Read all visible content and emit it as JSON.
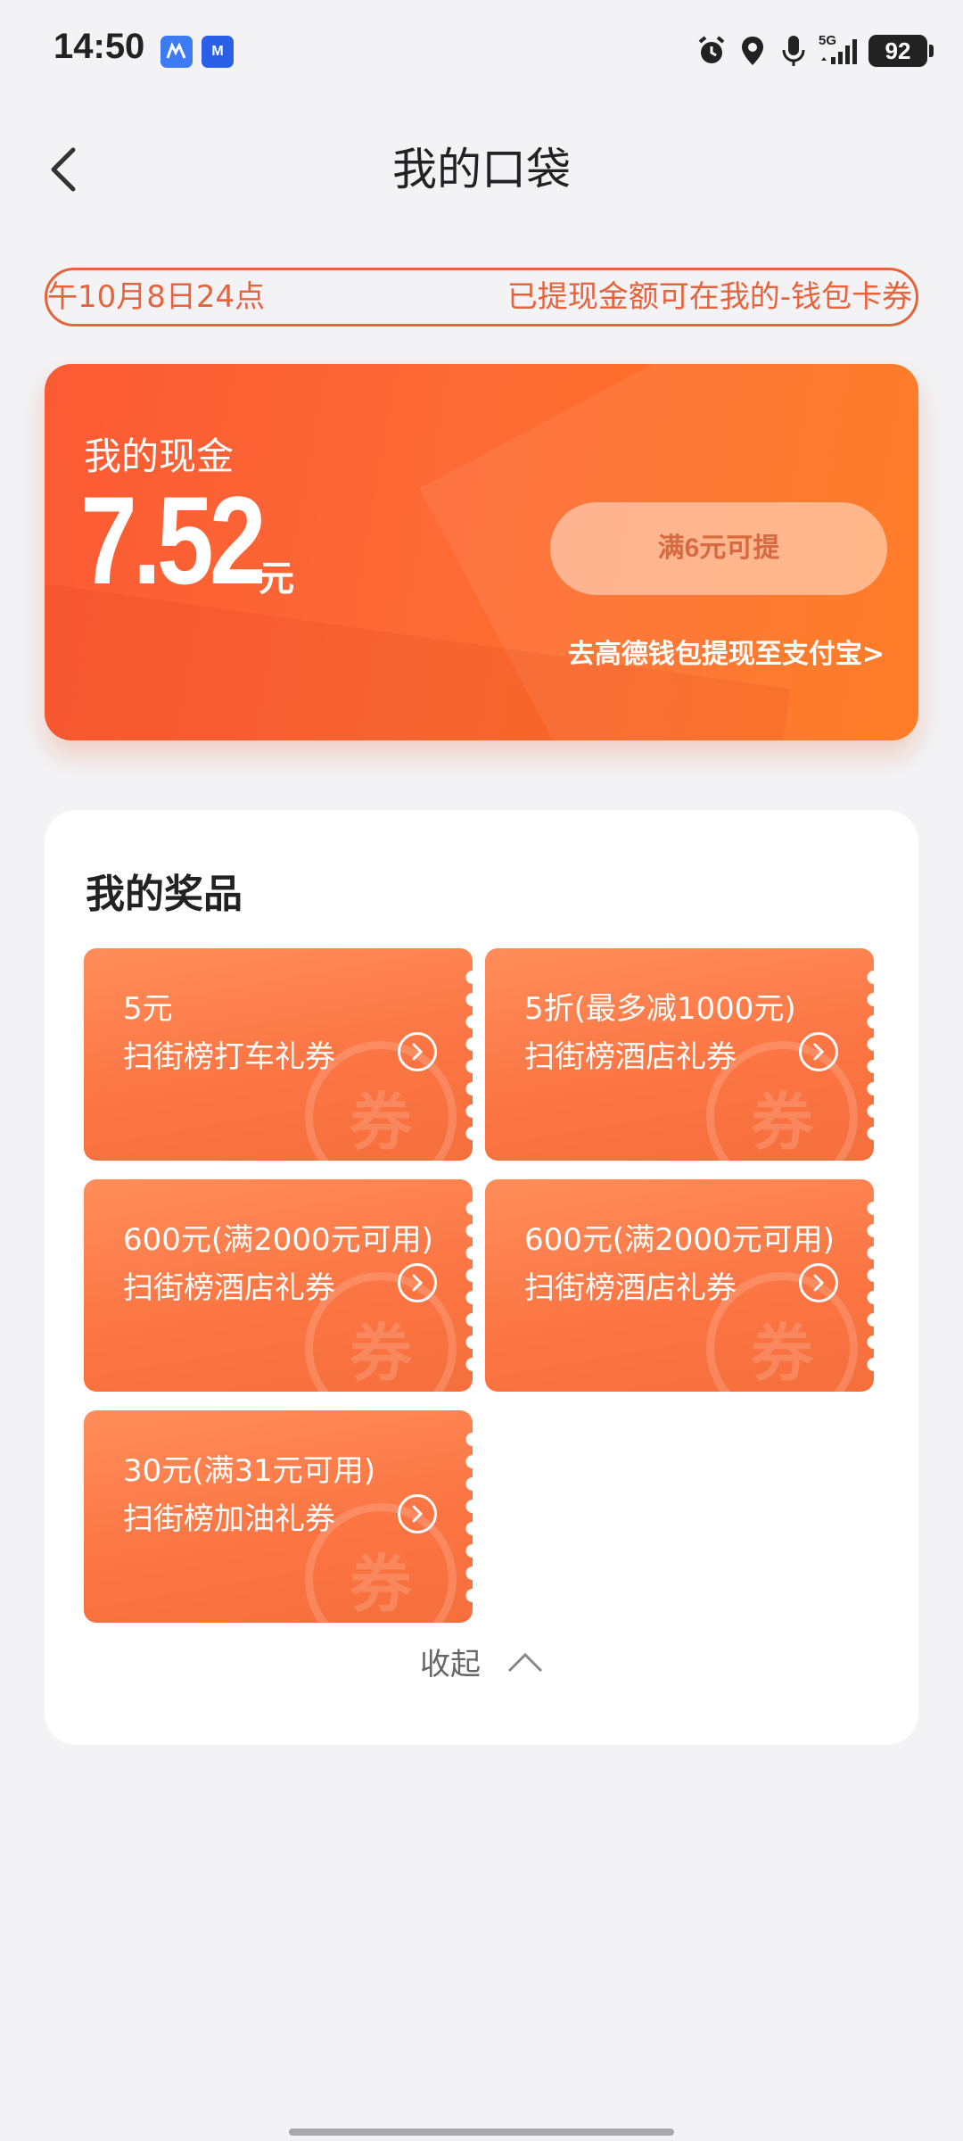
{
  "status_bar": {
    "time": "14:50",
    "app_icons": [
      "M"
    ],
    "network": "5G",
    "battery": "92"
  },
  "header": {
    "title": "我的口袋",
    "back_icon": "chevron-left-icon"
  },
  "notice": {
    "left_text": "午10月8日24点",
    "right_text": "已提现金额可在我的-钱包卡券"
  },
  "cash": {
    "label": "我的现金",
    "amount": "7.52",
    "unit": "元",
    "withdraw_button": "满6元可提",
    "alipay_link": "去高德钱包提现至支付宝>"
  },
  "prizes": {
    "title": "我的奖品",
    "items": [
      {
        "value": "5元",
        "name": "扫街榜打车礼券"
      },
      {
        "value": "5折(最多减1000元)",
        "name": "扫街榜酒店礼券"
      },
      {
        "value": "600元(满2000元可用)",
        "name": "扫街榜酒店礼券"
      },
      {
        "value": "600元(满2000元可用)",
        "name": "扫街榜酒店礼券"
      },
      {
        "value": "30元(满31元可用)",
        "name": "扫街榜加油礼券"
      }
    ],
    "watermark": "券",
    "collapse_label": "收起"
  },
  "colors": {
    "accent": "#fc5a34",
    "coupon": "#fb7442",
    "background": "#f3f3f5"
  }
}
